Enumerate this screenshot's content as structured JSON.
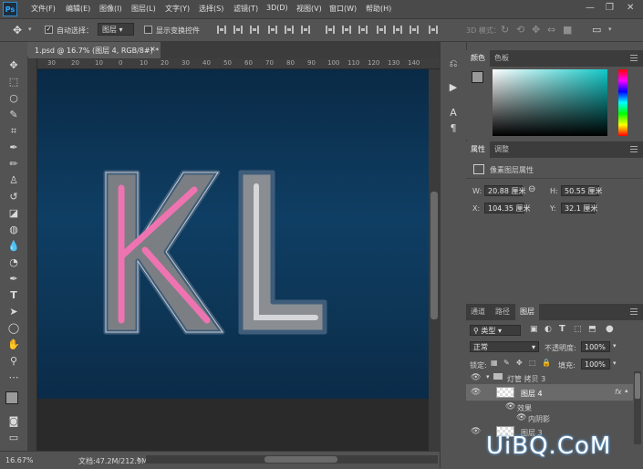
{
  "app": {
    "logo": "Ps"
  },
  "menu": [
    "文件(F)",
    "编辑(E)",
    "图像(I)",
    "图层(L)",
    "文字(Y)",
    "选择(S)",
    "滤镜(T)",
    "3D(D)",
    "视图(V)",
    "窗口(W)",
    "帮助(H)"
  ],
  "window_controls": {
    "minimize": "—",
    "restore": "❐",
    "close": "✕"
  },
  "options": {
    "auto_select_label": "自动选择：",
    "auto_select_checked": true,
    "auto_select_value": "图层",
    "show_transform_label": "显示变换控件",
    "mode_3d_label": "3D 模式："
  },
  "document": {
    "tab_title": "1.psd @ 16.7% (图层 4, RGB/8#) *",
    "tab_close": "×"
  },
  "ruler": {
    "top_ticks": [
      "30",
      "20",
      "10",
      "0",
      "10",
      "20",
      "30",
      "40",
      "50",
      "60",
      "70",
      "80",
      "90",
      "100",
      "110",
      "120",
      "130",
      "140"
    ]
  },
  "canvas": {
    "letters": "KL",
    "letter_k": "K",
    "letter_l": "L"
  },
  "status": {
    "zoom": "16.67%",
    "doc_info": "文档:47.2M/212.9M",
    "arrow": "›"
  },
  "color_panel": {
    "tabs": [
      "颜色",
      "色板"
    ],
    "active": 0,
    "fg": "#9a9a9a",
    "bg": "#ffffff",
    "hue": "#12c9c9"
  },
  "properties_panel": {
    "tabs": [
      "属性",
      "调整"
    ],
    "active": 0,
    "title": "像素图层属性",
    "w_label": "W:",
    "w_value": "20.88 厘米",
    "h_label": "H:",
    "h_value": "50.55 厘米",
    "x_label": "X:",
    "x_value": "104.35 厘米",
    "y_label": "Y:",
    "y_value": "32.1 厘米"
  },
  "layers_panel": {
    "tabs": [
      "通道",
      "路径",
      "图层"
    ],
    "active": 2,
    "filter_label": "类型",
    "blend_mode": "正常",
    "opacity_label": "不透明度:",
    "opacity_value": "100%",
    "lock_label": "锁定:",
    "fill_label": "填充:",
    "fill_value": "100%",
    "rows": [
      {
        "name": "灯管 拷贝 3",
        "kind": "group"
      },
      {
        "name": "图层 4",
        "kind": "layer",
        "fx": "fx",
        "selected": true
      },
      {
        "name": "效果",
        "kind": "effects"
      },
      {
        "name": "内阴影",
        "kind": "effect"
      },
      {
        "name": "图层 3",
        "kind": "layer"
      }
    ]
  },
  "watermark": {
    "text": "UiBQ.CoM"
  }
}
